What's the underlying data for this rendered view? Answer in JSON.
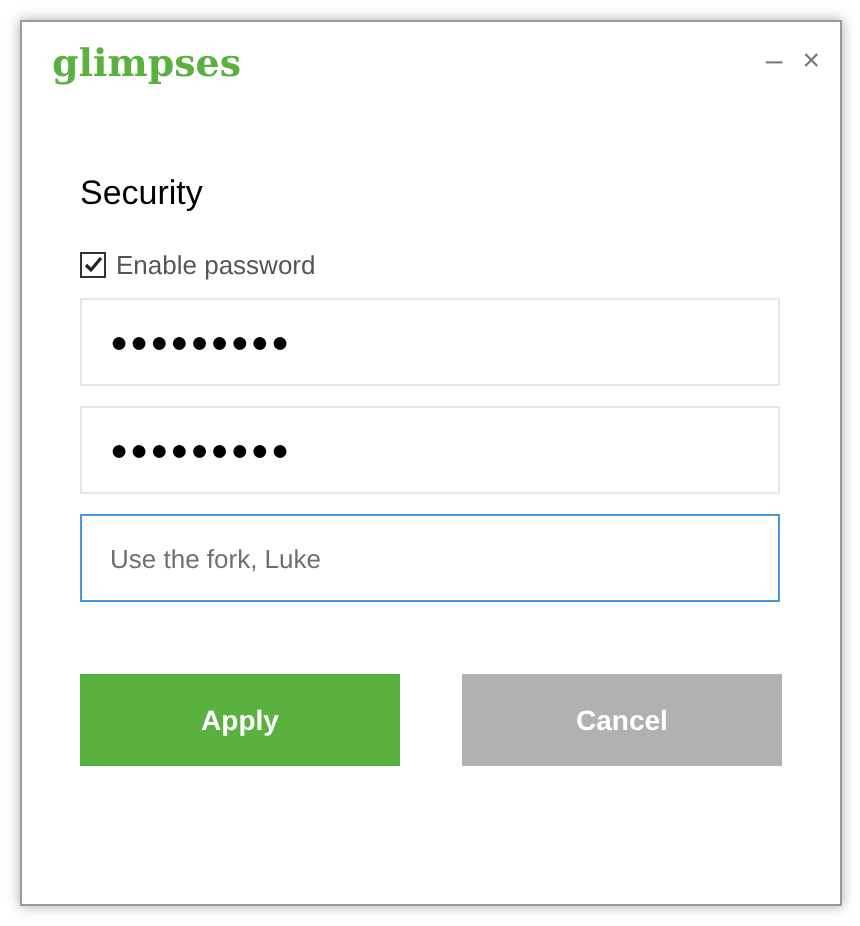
{
  "window": {
    "title": "glimpses",
    "controls": [
      "–",
      "×"
    ]
  },
  "section": {
    "heading": "Security"
  },
  "enable_password": {
    "label": "Enable password",
    "checked": true
  },
  "fields": [
    {
      "value": "●●●●●●●●●",
      "focused": false
    },
    {
      "value": "●●●●●●●●●",
      "focused": false
    },
    {
      "placeholder": "Use the fork, Luke",
      "focused": true
    }
  ],
  "buttons": [
    {
      "label": "Apply",
      "kind": "primary"
    },
    {
      "label": "Cancel",
      "kind": "secondary"
    }
  ]
}
